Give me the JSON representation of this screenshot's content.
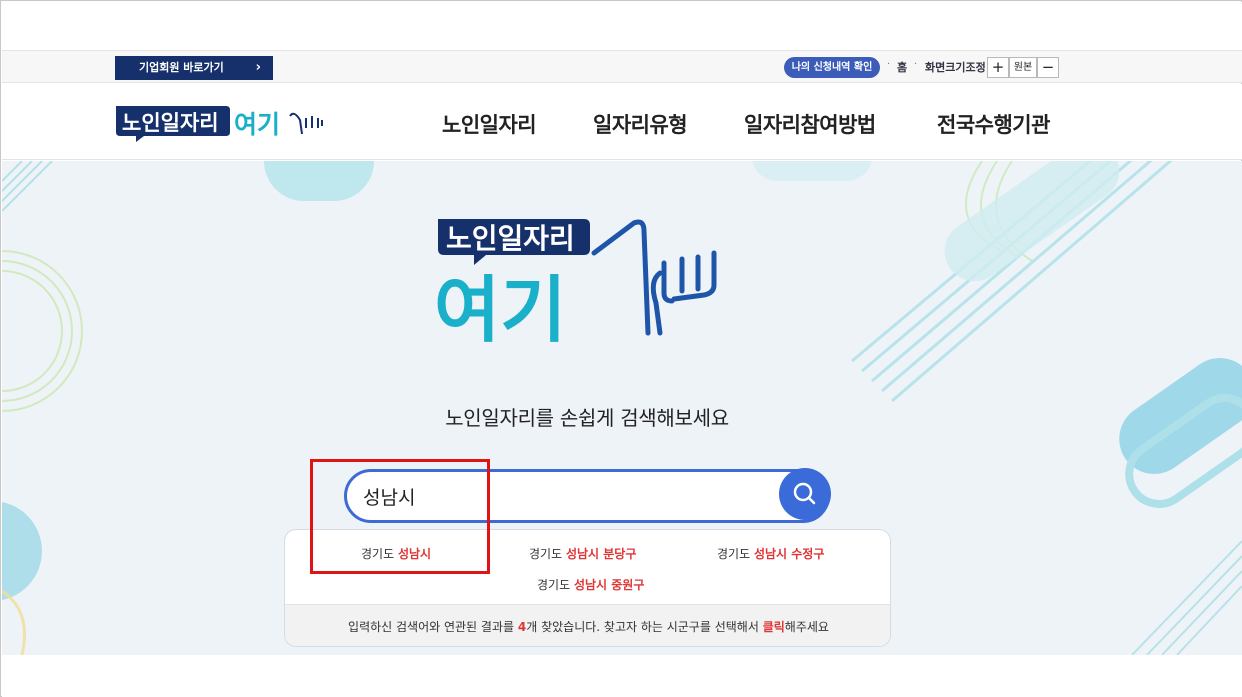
{
  "utility_bar": {
    "biz_link": "기업회원 바로가기",
    "biz_arrow": "›",
    "my_apply": "나의 신청내역 확인",
    "home": "홈",
    "font_size_label": "화면크기조정",
    "font_plus": "+",
    "font_original": "원본",
    "font_minus": "−",
    "separator": "·"
  },
  "header": {
    "logo_line1": "노인일자리",
    "logo_line2": "여기",
    "nav": [
      "노인일자리",
      "일자리유형",
      "일자리참여방법",
      "전국수행기관"
    ]
  },
  "hero": {
    "logo_line1": "노인일자리",
    "logo_line2": "여기",
    "tagline": "노인일자리를 손쉽게 검색해보세요"
  },
  "search": {
    "value": "성남시",
    "results": [
      {
        "prefix": "경기도 ",
        "match": "성남시"
      },
      {
        "prefix": "경기도 ",
        "match": "성남시 분당구"
      },
      {
        "prefix": "경기도 ",
        "match": "성남시 수정구"
      },
      {
        "prefix": "경기도 ",
        "match": "성남시 중원구"
      }
    ],
    "footer": {
      "part1": "입력하신 검색어와 연관된 결과를 ",
      "count": "4",
      "part2": "개 찾았습니다. 찾고자 하는 시군구를 선택해서 ",
      "click": "클릭",
      "part3": "해주세요"
    }
  },
  "colors": {
    "accent_navy": "#16306b",
    "accent_blue": "#3b6bd8",
    "highlight_red": "#e03535",
    "annotation_red": "#e01414",
    "teal": "#1ab0c9"
  }
}
